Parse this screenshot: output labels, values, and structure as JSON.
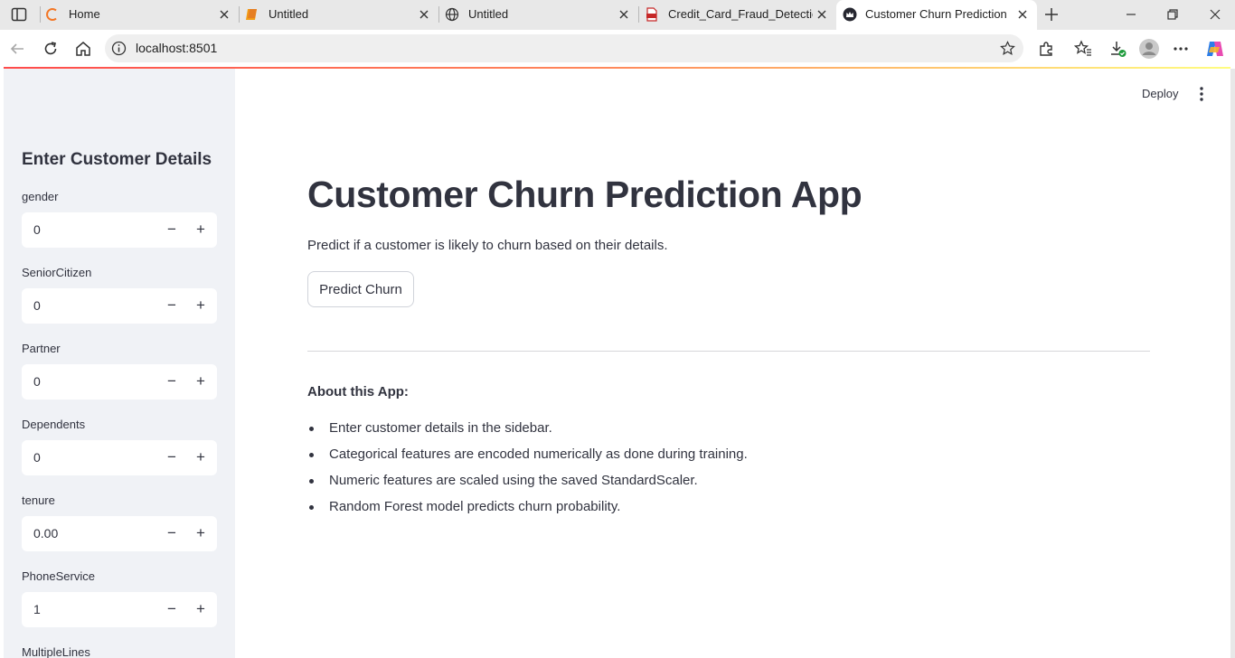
{
  "browser": {
    "tabs": [
      {
        "title": "Home",
        "icon": "home-loader-icon",
        "active": false
      },
      {
        "title": "Untitled",
        "icon": "notebook-icon",
        "active": false
      },
      {
        "title": "Untitled",
        "icon": "globe-icon",
        "active": false
      },
      {
        "title": "Credit_Card_Fraud_Detection.p",
        "icon": "pdf-icon",
        "active": false
      },
      {
        "title": "Customer Churn Prediction",
        "icon": "streamlit-crown-icon",
        "active": true
      }
    ],
    "url": "localhost:8501",
    "accent": "#ff4b4b"
  },
  "app": {
    "deploy_label": "Deploy",
    "title": "Customer Churn Prediction App",
    "description": "Predict if a customer is likely to churn based on their details.",
    "predict_button": "Predict Churn",
    "about_heading": "About this App:",
    "about_items": [
      "Enter customer details in the sidebar.",
      "Categorical features are encoded numerically as done during training.",
      "Numeric features are scaled using the saved StandardScaler.",
      "Random Forest model predicts churn probability."
    ]
  },
  "sidebar": {
    "header": "Enter Customer Details",
    "fields": [
      {
        "label": "gender",
        "value": "0"
      },
      {
        "label": "SeniorCitizen",
        "value": "0"
      },
      {
        "label": "Partner",
        "value": "0"
      },
      {
        "label": "Dependents",
        "value": "0"
      },
      {
        "label": "tenure",
        "value": "0.00"
      },
      {
        "label": "PhoneService",
        "value": "1"
      },
      {
        "label": "MultipleLines",
        "value": ""
      }
    ],
    "minus_symbol": "−",
    "plus_symbol": "+"
  }
}
